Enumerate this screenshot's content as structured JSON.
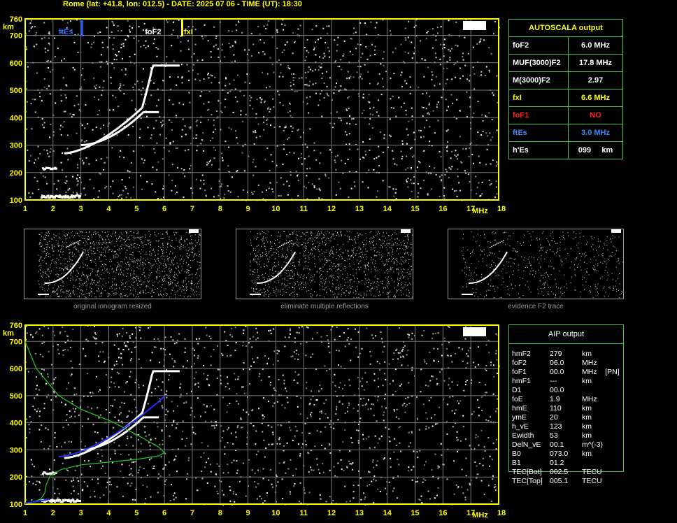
{
  "header": {
    "title": "Rome (lat: +41.8, lon: 012.5) - DATE: 2025 07 06 - TIME (UT): 18:30"
  },
  "ionogram": {
    "y_unit": "km",
    "x_unit": "MHz",
    "y_ticks": [
      "760",
      "700",
      "600",
      "500",
      "400",
      "300",
      "200",
      "100"
    ],
    "x_ticks": [
      "1",
      "2",
      "3",
      "4",
      "5",
      "6",
      "7",
      "8",
      "9",
      "10",
      "11",
      "12",
      "13",
      "14",
      "15",
      "16",
      "17",
      "18"
    ],
    "markers": {
      "ftEs": "ftEs",
      "foF2": "foF2",
      "fxI": "fxI"
    },
    "colors": {
      "axis": "#ffff00",
      "grid": "#7a7a7a",
      "ftEs": "#2266ff",
      "fxI": "#ffff00",
      "profile": "#22cc22",
      "fit": "#2233ff"
    }
  },
  "autoscala": {
    "title": "AUTOSCALA output",
    "rows": [
      {
        "label": "foF2",
        "value": "6.0 MHz",
        "color": "#ffffff"
      },
      {
        "label": "MUF(3000)F2",
        "value": "17.8 MHz",
        "color": "#ffffff"
      },
      {
        "label": "M(3000)F2",
        "value": "2.97",
        "color": "#ffffff"
      },
      {
        "label": "fxI",
        "value": "6.6 MHz",
        "color": "#ffff00"
      },
      {
        "label": "foF1",
        "value": "NO",
        "color": "#ff2020"
      },
      {
        "label": "ftEs",
        "value": "3.0 MHz",
        "color": "#3a8cff"
      },
      {
        "label": "h'Es",
        "value": "099     km",
        "color": "#ffffff"
      }
    ]
  },
  "thumbnails": [
    {
      "title": "original ionogram resized"
    },
    {
      "title": "eliminate multiple reflections"
    },
    {
      "title": "evidence F2 trace"
    }
  ],
  "aip": {
    "title": "AIP output",
    "rows": [
      {
        "label": "hmF2",
        "value": "279",
        "unit": "km"
      },
      {
        "label": "foF2",
        "value": "06.0",
        "unit": "MHz"
      },
      {
        "label": "foF1",
        "value": "00.0",
        "unit": "MHz    [PN]"
      },
      {
        "label": "hmF1",
        "value": "---",
        "unit": "km"
      },
      {
        "label": "D1",
        "value": "00.0",
        "unit": ""
      },
      {
        "label": "foE",
        "value": "1.9",
        "unit": "MHz"
      },
      {
        "label": "hmE",
        "value": "110",
        "unit": "km"
      },
      {
        "label": "ymE",
        "value": "20",
        "unit": "km"
      },
      {
        "label": "h_vE",
        "value": "123",
        "unit": "km"
      },
      {
        "label": "Ewidth",
        "value": "53",
        "unit": "km"
      },
      {
        "label": "DelN_vE",
        "value": "00.1",
        "unit": "m^(-3)"
      },
      {
        "label": "B0",
        "value": "073.0",
        "unit": "km"
      },
      {
        "label": "B1",
        "value": "01.2",
        "unit": ""
      },
      {
        "label": "TEC[Bot]",
        "value": "002.5",
        "unit": "TECU"
      },
      {
        "label": "TEC[Top]",
        "value": "005.1",
        "unit": "TECU"
      }
    ]
  }
}
